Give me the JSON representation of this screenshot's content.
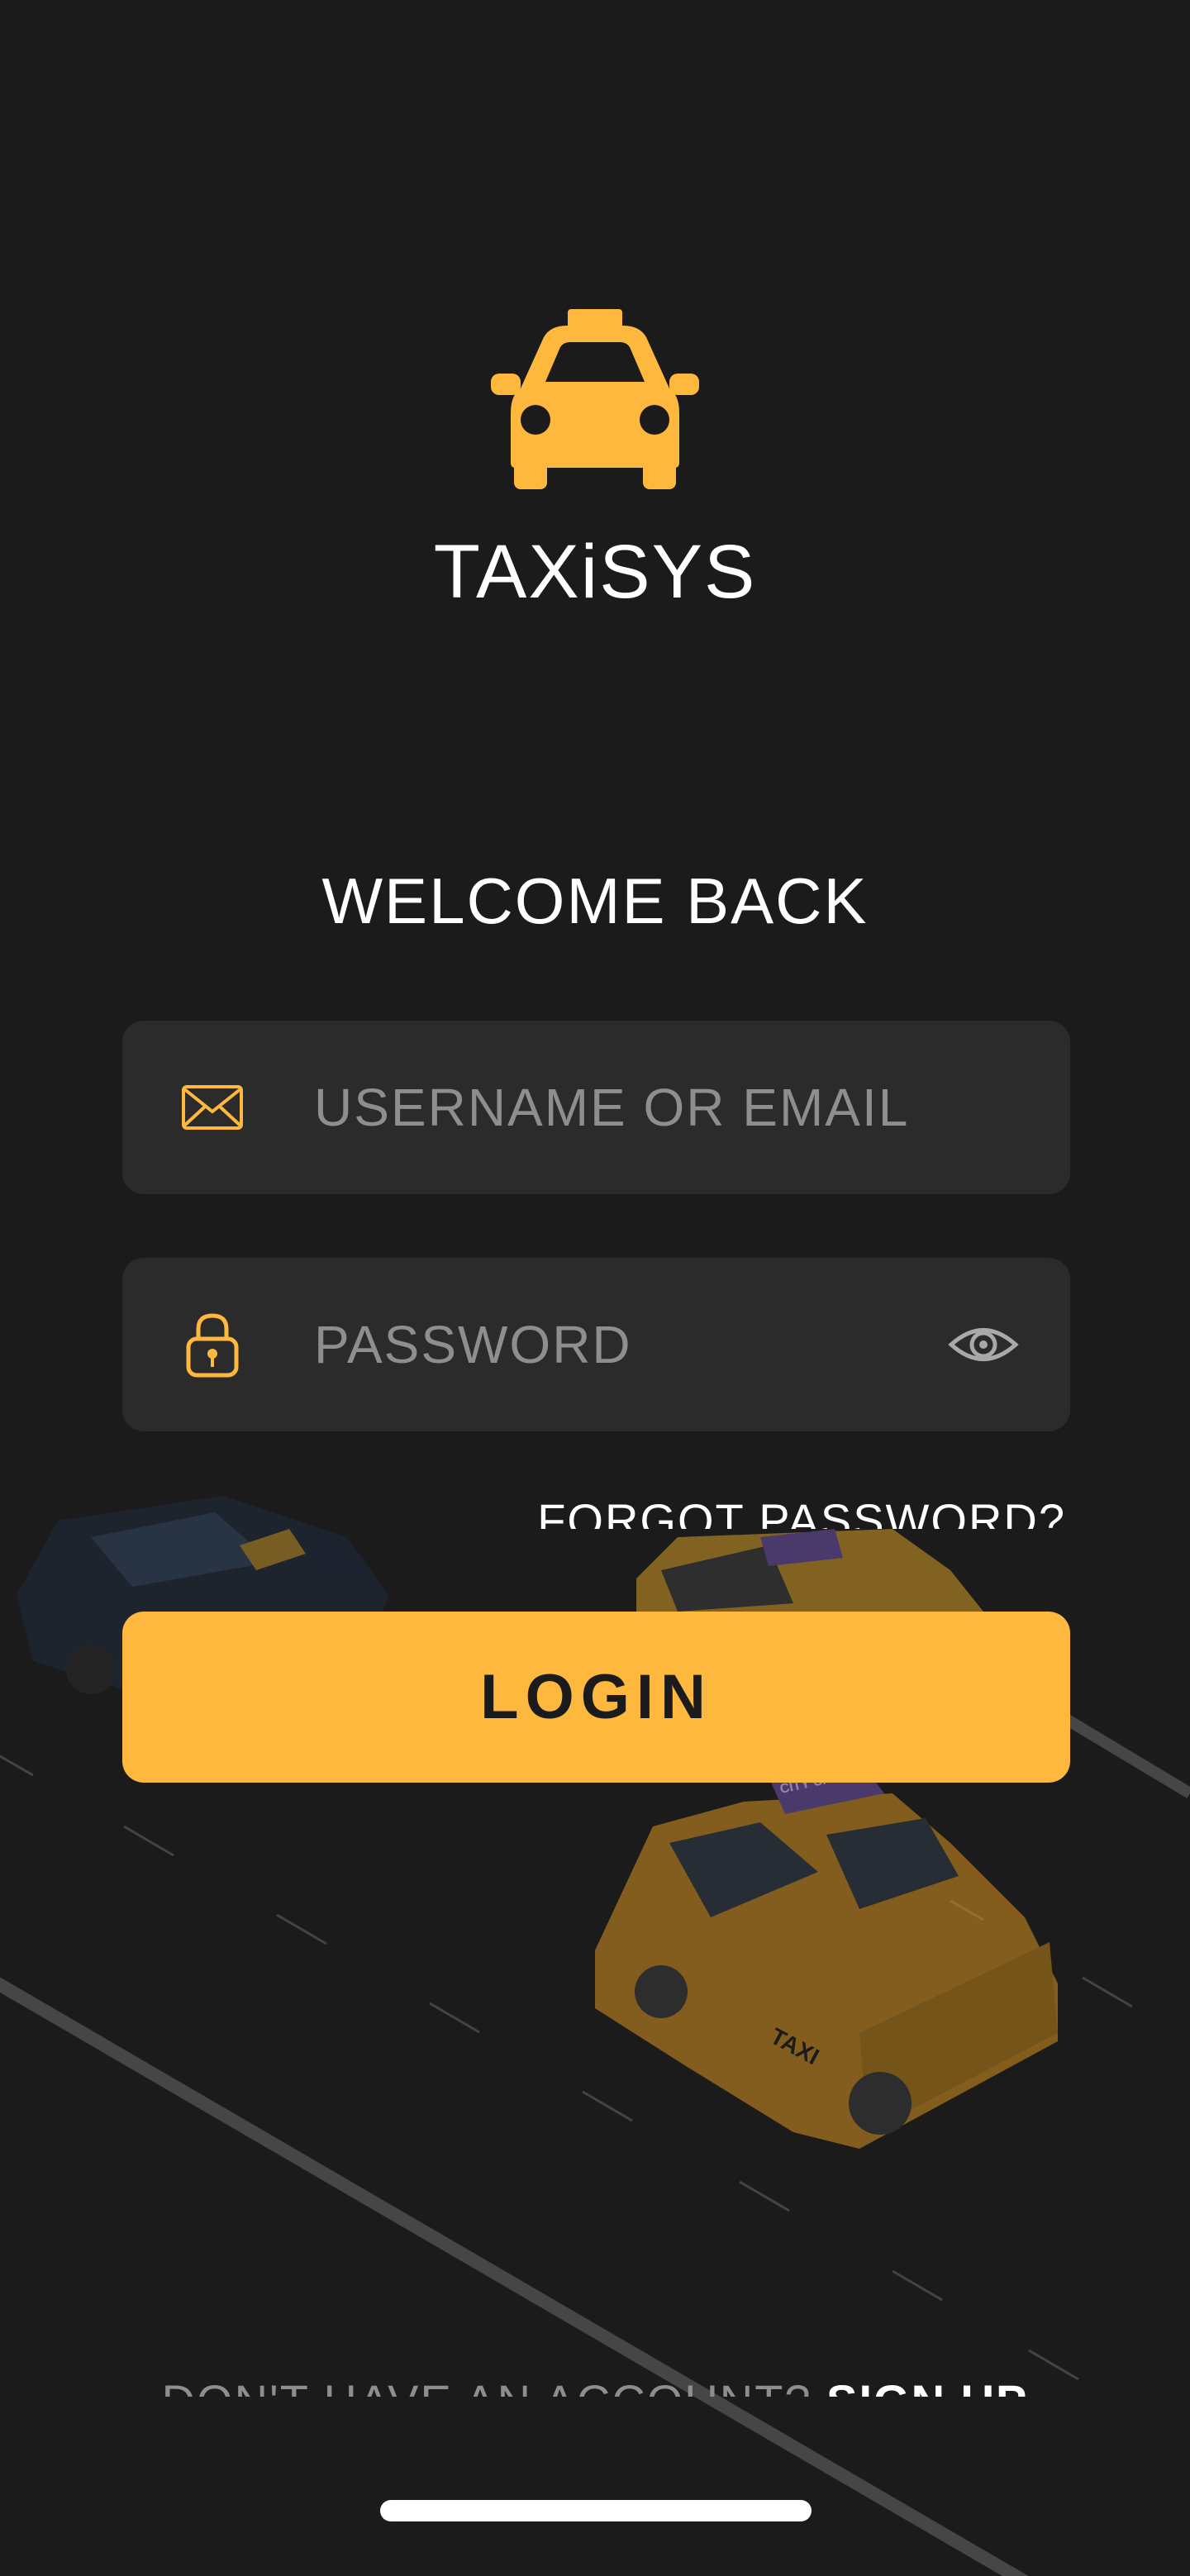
{
  "app": {
    "brand_name": "TAXiSYS",
    "welcome_title": "WELCOME BACK"
  },
  "form": {
    "username": {
      "placeholder": "USERNAME OR EMAIL",
      "value": "",
      "icon": "envelope-icon"
    },
    "password": {
      "placeholder": "PASSWORD",
      "value": "",
      "icon": "padlock-icon",
      "toggle_icon": "eye-icon"
    },
    "forgot_password_label": "FORGOT PASSWORD?",
    "login_label": "LOGIN"
  },
  "signup": {
    "prompt": "DON'T HAVE AN ACCOUNT? ",
    "link_label": "SIGN UP"
  },
  "theme": {
    "background": "#1b1b1c",
    "field_background": "#2b2b2c",
    "accent": "#ffb83e",
    "placeholder": "#8e8e8e",
    "text": "#ffffff"
  },
  "illustration": {
    "taxi_sign_text": "CITY CAB",
    "taxi_door_text": "TAXI"
  }
}
